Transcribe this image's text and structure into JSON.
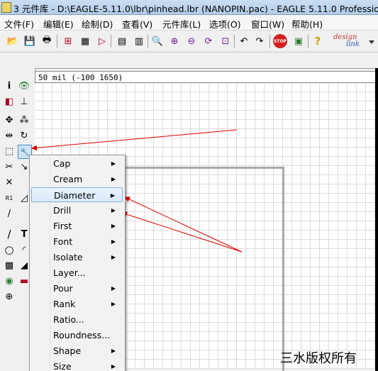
{
  "window": {
    "title": "3 元件库 - D:\\EAGLE-5.11.0\\lbr\\pinhead.lbr (NANOPIN.pac) - EAGLE 5.11.0 Professional"
  },
  "menubar": {
    "items": [
      "文件(F)",
      "编辑(E)",
      "绘制(D)",
      "查看(V)",
      "元件库(L)",
      "选项(O)",
      "窗口(W)",
      "帮助(H)"
    ]
  },
  "toolbar": {
    "buttons": [
      {
        "icon": "open-folder-icon",
        "glyph": "📂"
      },
      {
        "icon": "save-icon",
        "glyph": "💾"
      },
      {
        "icon": "print-icon",
        "glyph": "🖶"
      },
      {
        "icon": "cam-processor-icon",
        "glyph": "⊞"
      },
      {
        "icon": "schematic-icon",
        "glyph": "▦"
      },
      {
        "icon": "symbol-icon",
        "glyph": "▷"
      },
      {
        "icon": "script-icon",
        "glyph": "▤"
      },
      {
        "icon": "ulp-icon",
        "glyph": "▥"
      },
      {
        "icon": "zoom-fit-icon",
        "glyph": "🔍"
      },
      {
        "icon": "zoom-in-icon",
        "glyph": "⊕"
      },
      {
        "icon": "zoom-out-icon",
        "glyph": "⊖"
      },
      {
        "icon": "redraw-icon",
        "glyph": "⟳"
      },
      {
        "icon": "zoom-select-icon",
        "glyph": "⊡"
      },
      {
        "icon": "undo-icon",
        "glyph": "↶"
      },
      {
        "icon": "redo-icon",
        "glyph": "↷"
      },
      {
        "icon": "stop-icon",
        "glyph": "STOP"
      },
      {
        "icon": "go-icon",
        "glyph": "▣"
      },
      {
        "icon": "help-icon",
        "glyph": "?"
      }
    ],
    "logo_line1": "design",
    "logo_line2": "link"
  },
  "coordinates": {
    "text": "50 mil  (-100  1650)"
  },
  "left_tools": [
    {
      "icon": "info-icon",
      "glyph": "i"
    },
    {
      "icon": "eye-icon",
      "glyph": "👁"
    },
    {
      "icon": "layer-display-icon",
      "glyph": "◧"
    },
    {
      "icon": "mark-icon",
      "glyph": "⊥"
    },
    {
      "icon": "move-icon",
      "glyph": "✥"
    },
    {
      "icon": "copy-icon",
      "glyph": "⁂"
    },
    {
      "icon": "mirror-icon",
      "glyph": "⇹"
    },
    {
      "icon": "rotate-icon",
      "glyph": "↻"
    },
    {
      "icon": "group-icon",
      "glyph": "⬚"
    },
    {
      "icon": "change-wrench-icon",
      "glyph": "🔧"
    },
    {
      "icon": "cut-icon",
      "glyph": "✂"
    },
    {
      "icon": "paste-icon",
      "glyph": "↘"
    },
    {
      "icon": "delete-icon",
      "glyph": "✕"
    },
    {
      "icon": "name-icon",
      "glyph": "R1"
    },
    {
      "icon": "value-icon",
      "glyph": "◿"
    },
    {
      "icon": "wire-icon",
      "glyph": "/"
    },
    {
      "icon": "text-icon",
      "glyph": "T"
    },
    {
      "icon": "circle-icon",
      "glyph": "○"
    },
    {
      "icon": "arc-icon",
      "glyph": "◜"
    },
    {
      "icon": "rect-icon",
      "glyph": "▩"
    },
    {
      "icon": "polygon-icon",
      "glyph": "◢"
    },
    {
      "icon": "pad-icon",
      "glyph": "◉"
    },
    {
      "icon": "smd-icon",
      "glyph": "▬"
    },
    {
      "icon": "hole-icon",
      "glyph": "⊕"
    }
  ],
  "context_menu": {
    "items": [
      {
        "label": "Cap",
        "submenu": true
      },
      {
        "label": "Cream",
        "submenu": true
      },
      {
        "label": "Diameter",
        "submenu": true,
        "highlighted": true
      },
      {
        "label": "Drill",
        "submenu": true
      },
      {
        "label": "First",
        "submenu": true
      },
      {
        "label": "Font",
        "submenu": true
      },
      {
        "label": "Isolate",
        "submenu": true
      },
      {
        "label": "Layer...",
        "submenu": false
      },
      {
        "label": "Pour",
        "submenu": true
      },
      {
        "label": "Rank",
        "submenu": true
      },
      {
        "label": "Ratio...",
        "submenu": false
      },
      {
        "label": "Roundness...",
        "submenu": false
      },
      {
        "label": "Shape",
        "submenu": true
      },
      {
        "label": "Size",
        "submenu": true
      }
    ]
  },
  "watermark": "三水版权所有",
  "colors": {
    "annotation_arrow": "#e00000",
    "menu_highlight": "#d9e9fb",
    "grid": "#dcdcdc"
  }
}
